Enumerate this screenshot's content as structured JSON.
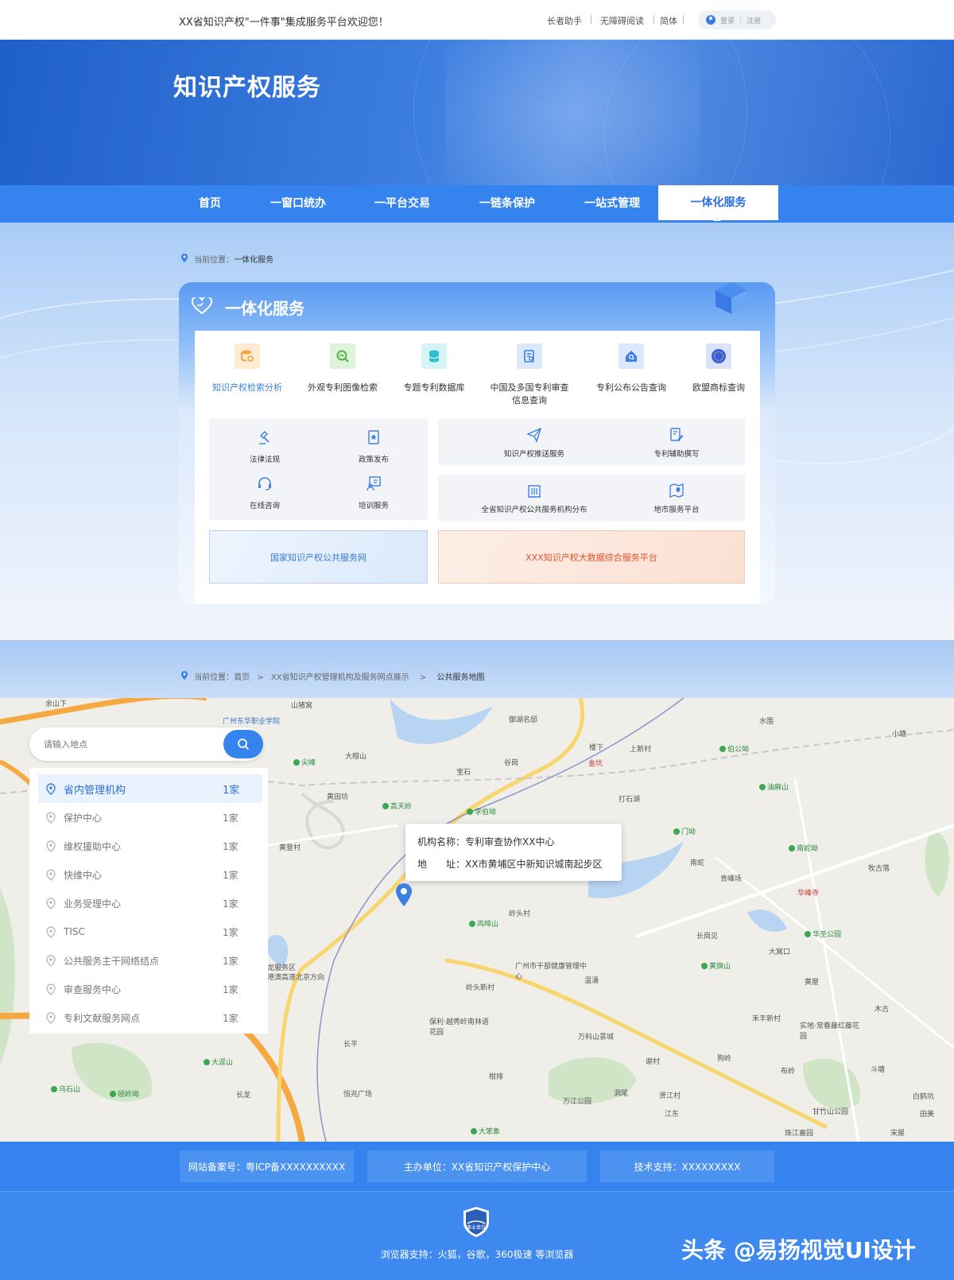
{
  "topbar": {
    "welcome": "XX省知识产权\"一件事\"集成服务平台欢迎您！",
    "links": [
      "长者助手",
      "无障碍阅读",
      "简体"
    ],
    "login": "登录",
    "register": "注册"
  },
  "hero": {
    "title": "知识产权服务"
  },
  "nav": {
    "items": [
      "首页",
      "一窗口统办",
      "一平台交易",
      "一链条保护",
      "一站式管理",
      "一体化服务"
    ],
    "active_index": 5
  },
  "breadcrumb1": {
    "prefix": "当前位置：",
    "current": "一体化服务"
  },
  "card": {
    "title": "一体化服务",
    "quick": [
      {
        "label": "知识产权检索分析",
        "icon": "database-search-icon",
        "color": "#f6a23a",
        "bg": "#fdebd4",
        "active": true
      },
      {
        "label": "外观专利图像检索",
        "icon": "image-search-icon",
        "color": "#4cb548",
        "bg": "#dff3da"
      },
      {
        "label": "专题专利数据库",
        "icon": "database-icon",
        "color": "#2cbfcf",
        "bg": "#d6f3f6"
      },
      {
        "label": "中国及多国专利审查",
        "label2": "信息查询",
        "icon": "document-search-icon",
        "color": "#3a80e5",
        "bg": "#dbe8fb"
      },
      {
        "label": "专利公布公告查询",
        "icon": "house-search-icon",
        "color": "#3a80e5",
        "bg": "#dbe8fb"
      },
      {
        "label": "欧盟商标查询",
        "icon": "eu-circle-icon",
        "color": "#3a5fd8",
        "bg": "#dbe3fb"
      }
    ],
    "left_services": [
      "法律法规",
      "政策发布",
      "在线咨询",
      "培训服务"
    ],
    "right_top": [
      "知识产权推送服务",
      "专利辅助撰写"
    ],
    "right_bottom": [
      "全省知识产权公共服务机构分布",
      "地市服务平台"
    ],
    "banner_left": "国家知识产权公共服务网",
    "banner_right": "XXX知识产权大数据综合服务平台"
  },
  "breadcrumb2": {
    "prefix": "当前位置：",
    "items": [
      "首页",
      "XX省知识产权管理机构及服务网点展示",
      "公共服务地图"
    ],
    "sep": ">"
  },
  "map": {
    "search_placeholder": "请输入地点",
    "categories": [
      {
        "name": "省内管理机构",
        "count": "1家",
        "selected": true
      },
      {
        "name": "保护中心",
        "count": "1家"
      },
      {
        "name": "维权援助中心",
        "count": "1家"
      },
      {
        "name": "快维中心",
        "count": "1家"
      },
      {
        "name": "业务受理中心",
        "count": "1家"
      },
      {
        "name": "TISC",
        "count": "1家"
      },
      {
        "name": "公共服务主干网络结点",
        "count": "1家"
      },
      {
        "name": "审查服务中心",
        "count": "1家"
      },
      {
        "name": "专利文献服务网点",
        "count": "1家"
      }
    ],
    "popup": {
      "name_label": "机构名称：",
      "name": "专利审查协作XX中心",
      "addr_label": "地　　址：",
      "addr": "XX市黄埔区中新知识城南起步区"
    },
    "labels": [
      "广州东华职业学院",
      "御湖名邸",
      "水围",
      "小塘",
      "大榕山",
      "宝石",
      "谷岗",
      "楼下",
      "上新村",
      "伯公坳",
      "尖峰",
      "金坑",
      "油麻山",
      "黄田坊",
      "高天岭",
      "李伯坳",
      "打石湖",
      "门坳",
      "南蛇坳",
      "黄登村",
      "南蛇",
      "牧古落",
      "青峰场",
      "华峰寺",
      "岭头村",
      "鸡啼山",
      "长岗见",
      "华圣公园",
      "黄旗山",
      "广州市干部健康管理中心",
      "温涌",
      "大窝口",
      "黄屋",
      "木古",
      "岭头新村",
      "保利·越秀岭南林语花园",
      "禾丰新村",
      "实地·常春藤红藤花园",
      "万科山景城",
      "长平",
      "大逕山",
      "乌石山",
      "班岭坳",
      "恒兆广场",
      "长龙",
      "柑排",
      "万江公园",
      "洞尾",
      "贤江村",
      "谢村",
      "狗岭",
      "布岭",
      "斗塘",
      "白鹤坑",
      "大笨象",
      "江东",
      "甘竹山公园",
      "珠江嘉园",
      "宋屋",
      "田美",
      "余山下",
      "山猪窝",
      "龙服务区",
      "港澳高速北京方向"
    ]
  },
  "footer": {
    "icp": "网站备案号：粤ICP备XXXXXXXXXX",
    "organizer": "主办单位：XX省知识产权保护中心",
    "support": "技术支持：XXXXXXXXX",
    "badge": "事业单位",
    "browsers": "浏览器支持：火狐，谷歌，360极速 等浏览器",
    "watermark": "头条 @易扬视觉UI设计"
  },
  "colors": {
    "primary": "#3583ee",
    "accent_orange": "#e4522f"
  }
}
